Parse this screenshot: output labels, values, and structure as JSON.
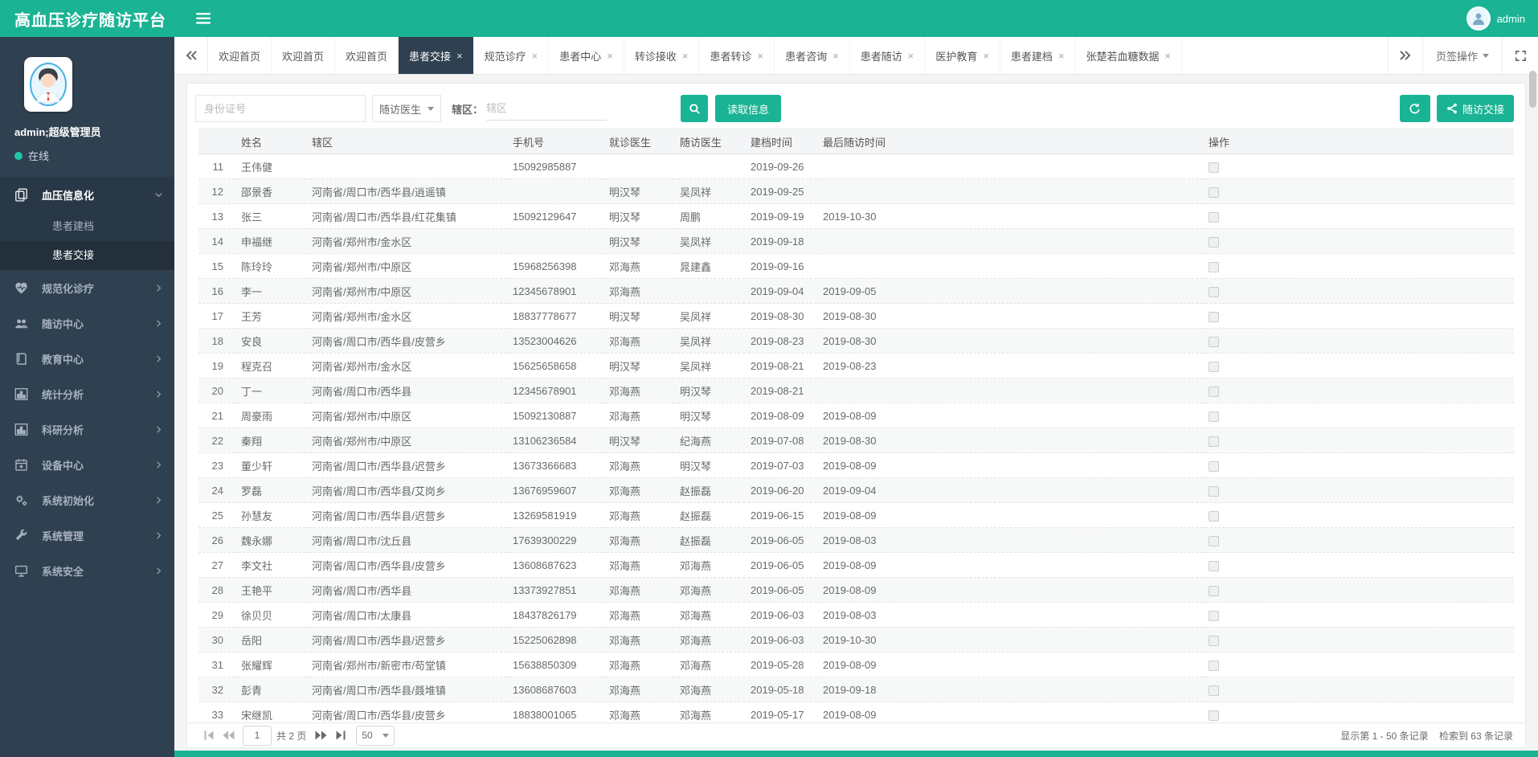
{
  "colors": {
    "accent": "#1ab394",
    "sidebar": "#2f4050",
    "sidebar_expanded": "#293846"
  },
  "topbar": {
    "title": "高血压诊疗随访平台",
    "user": "admin"
  },
  "sidebar": {
    "user": "admin;超级管理员",
    "status": "在线",
    "menu": [
      {
        "label": "血压信息化",
        "icon": "copy-icon",
        "expanded": true,
        "children": [
          {
            "label": "患者建档",
            "active": false
          },
          {
            "label": "患者交接",
            "active": true
          }
        ]
      },
      {
        "label": "规范化诊疗",
        "icon": "heartbeat-icon"
      },
      {
        "label": "随访中心",
        "icon": "users-icon"
      },
      {
        "label": "教育中心",
        "icon": "book-icon"
      },
      {
        "label": "统计分析",
        "icon": "bar-chart-icon"
      },
      {
        "label": "科研分析",
        "icon": "bar-chart-icon"
      },
      {
        "label": "设备中心",
        "icon": "calendar-icon"
      },
      {
        "label": "系统初始化",
        "icon": "gears-icon"
      },
      {
        "label": "系统管理",
        "icon": "wrench-icon"
      },
      {
        "label": "系统安全",
        "icon": "desktop-icon"
      }
    ]
  },
  "tabbar": {
    "tabs": [
      {
        "label": "欢迎首页",
        "closable": false,
        "active": false
      },
      {
        "label": "欢迎首页",
        "closable": false,
        "active": false
      },
      {
        "label": "欢迎首页",
        "closable": false,
        "active": false
      },
      {
        "label": "患者交接",
        "closable": true,
        "active": true
      },
      {
        "label": "规范诊疗",
        "closable": true,
        "active": false
      },
      {
        "label": "患者中心",
        "closable": true,
        "active": false
      },
      {
        "label": "转诊接收",
        "closable": true,
        "active": false
      },
      {
        "label": "患者转诊",
        "closable": true,
        "active": false
      },
      {
        "label": "患者咨询",
        "closable": true,
        "active": false
      },
      {
        "label": "患者随访",
        "closable": true,
        "active": false
      },
      {
        "label": "医护教育",
        "closable": true,
        "active": false
      },
      {
        "label": "患者建档",
        "closable": true,
        "active": false
      },
      {
        "label": "张楚若血糖数据",
        "closable": true,
        "active": false
      }
    ],
    "ops_label": "页签操作"
  },
  "toolbar": {
    "id_placeholder": "身份证号",
    "doctor_select_value": "随访医生",
    "region_label": "辖区：",
    "region_placeholder": "辖区",
    "read_button": "读取信息",
    "handover_button": "随访交接"
  },
  "table": {
    "columns": [
      "姓名",
      "辖区",
      "手机号",
      "就诊医生",
      "随访医生",
      "建档时间",
      "最后随访时间",
      "操作"
    ],
    "rows": [
      {
        "n": 11,
        "name": "王伟健",
        "region": "",
        "phone": "15092985887",
        "visit_doctor": "",
        "follow_doctor": "",
        "created": "2019-09-26",
        "last_visit": ""
      },
      {
        "n": 12,
        "name": "邵景香",
        "region": "河南省/周口市/西华县/逍遥镇",
        "phone": "",
        "visit_doctor": "明汉琴",
        "follow_doctor": "吴凤祥",
        "created": "2019-09-25",
        "last_visit": ""
      },
      {
        "n": 13,
        "name": "张三",
        "region": "河南省/周口市/西华县/红花集镇",
        "phone": "15092129647",
        "visit_doctor": "明汉琴",
        "follow_doctor": "周鹏",
        "created": "2019-09-19",
        "last_visit": "2019-10-30"
      },
      {
        "n": 14,
        "name": "申福继",
        "region": "河南省/郑州市/金水区",
        "phone": "",
        "visit_doctor": "明汉琴",
        "follow_doctor": "吴凤祥",
        "created": "2019-09-18",
        "last_visit": ""
      },
      {
        "n": 15,
        "name": "陈玲玲",
        "region": "河南省/郑州市/中原区",
        "phone": "15968256398",
        "visit_doctor": "邓海燕",
        "follow_doctor": "晁建鑫",
        "created": "2019-09-16",
        "last_visit": ""
      },
      {
        "n": 16,
        "name": "李一",
        "region": "河南省/郑州市/中原区",
        "phone": "12345678901",
        "visit_doctor": "邓海燕",
        "follow_doctor": "",
        "created": "2019-09-04",
        "last_visit": "2019-09-05"
      },
      {
        "n": 17,
        "name": "王芳",
        "region": "河南省/郑州市/金水区",
        "phone": "18837778677",
        "visit_doctor": "明汉琴",
        "follow_doctor": "吴凤祥",
        "created": "2019-08-30",
        "last_visit": "2019-08-30"
      },
      {
        "n": 18,
        "name": "安良",
        "region": "河南省/周口市/西华县/皮营乡",
        "phone": "13523004626",
        "visit_doctor": "邓海燕",
        "follow_doctor": "吴凤祥",
        "created": "2019-08-23",
        "last_visit": "2019-08-30"
      },
      {
        "n": 19,
        "name": "程克召",
        "region": "河南省/郑州市/金水区",
        "phone": "15625658658",
        "visit_doctor": "明汉琴",
        "follow_doctor": "吴凤祥",
        "created": "2019-08-21",
        "last_visit": "2019-08-23"
      },
      {
        "n": 20,
        "name": "丁一",
        "region": "河南省/周口市/西华县",
        "phone": "12345678901",
        "visit_doctor": "邓海燕",
        "follow_doctor": "明汉琴",
        "created": "2019-08-21",
        "last_visit": ""
      },
      {
        "n": 21,
        "name": "周豪雨",
        "region": "河南省/郑州市/中原区",
        "phone": "15092130887",
        "visit_doctor": "邓海燕",
        "follow_doctor": "明汉琴",
        "created": "2019-08-09",
        "last_visit": "2019-08-09"
      },
      {
        "n": 22,
        "name": "秦翔",
        "region": "河南省/郑州市/中原区",
        "phone": "13106236584",
        "visit_doctor": "明汉琴",
        "follow_doctor": "纪海燕",
        "created": "2019-07-08",
        "last_visit": "2019-08-30"
      },
      {
        "n": 23,
        "name": "董少轩",
        "region": "河南省/周口市/西华县/迟营乡",
        "phone": "13673366683",
        "visit_doctor": "邓海燕",
        "follow_doctor": "明汉琴",
        "created": "2019-07-03",
        "last_visit": "2019-08-09"
      },
      {
        "n": 24,
        "name": "罗磊",
        "region": "河南省/周口市/西华县/艾岗乡",
        "phone": "13676959607",
        "visit_doctor": "邓海燕",
        "follow_doctor": "赵振磊",
        "created": "2019-06-20",
        "last_visit": "2019-09-04"
      },
      {
        "n": 25,
        "name": "孙慧友",
        "region": "河南省/周口市/西华县/迟营乡",
        "phone": "13269581919",
        "visit_doctor": "邓海燕",
        "follow_doctor": "赵振磊",
        "created": "2019-06-15",
        "last_visit": "2019-08-09"
      },
      {
        "n": 26,
        "name": "魏永娜",
        "region": "河南省/周口市/沈丘县",
        "phone": "17639300229",
        "visit_doctor": "邓海燕",
        "follow_doctor": "赵振磊",
        "created": "2019-06-05",
        "last_visit": "2019-08-03"
      },
      {
        "n": 27,
        "name": "李文社",
        "region": "河南省/周口市/西华县/皮营乡",
        "phone": "13608687623",
        "visit_doctor": "邓海燕",
        "follow_doctor": "邓海燕",
        "created": "2019-06-05",
        "last_visit": "2019-08-09"
      },
      {
        "n": 28,
        "name": "王艳平",
        "region": "河南省/周口市/西华县",
        "phone": "13373927851",
        "visit_doctor": "邓海燕",
        "follow_doctor": "邓海燕",
        "created": "2019-06-05",
        "last_visit": "2019-08-09"
      },
      {
        "n": 29,
        "name": "徐贝贝",
        "region": "河南省/周口市/太康县",
        "phone": "18437826179",
        "visit_doctor": "邓海燕",
        "follow_doctor": "邓海燕",
        "created": "2019-06-03",
        "last_visit": "2019-08-03"
      },
      {
        "n": 30,
        "name": "岳阳",
        "region": "河南省/周口市/西华县/迟营乡",
        "phone": "15225062898",
        "visit_doctor": "邓海燕",
        "follow_doctor": "邓海燕",
        "created": "2019-06-03",
        "last_visit": "2019-10-30"
      },
      {
        "n": 31,
        "name": "张耀辉",
        "region": "河南省/郑州市/新密市/苟堂镇",
        "phone": "15638850309",
        "visit_doctor": "邓海燕",
        "follow_doctor": "邓海燕",
        "created": "2019-05-28",
        "last_visit": "2019-08-09"
      },
      {
        "n": 32,
        "name": "彭青",
        "region": "河南省/周口市/西华县/聂堆镇",
        "phone": "13608687603",
        "visit_doctor": "邓海燕",
        "follow_doctor": "邓海燕",
        "created": "2019-05-18",
        "last_visit": "2019-09-18"
      },
      {
        "n": 33,
        "name": "宋继凯",
        "region": "河南省/周口市/西华县/皮营乡",
        "phone": "18838001065",
        "visit_doctor": "邓海燕",
        "follow_doctor": "邓海燕",
        "created": "2019-05-17",
        "last_visit": "2019-08-09"
      }
    ]
  },
  "pager": {
    "page": "1",
    "total_label": "共 2 页",
    "page_size": "50",
    "info_left": "显示第 1 - 50 条记录",
    "info_right": "检索到 63 条记录"
  }
}
